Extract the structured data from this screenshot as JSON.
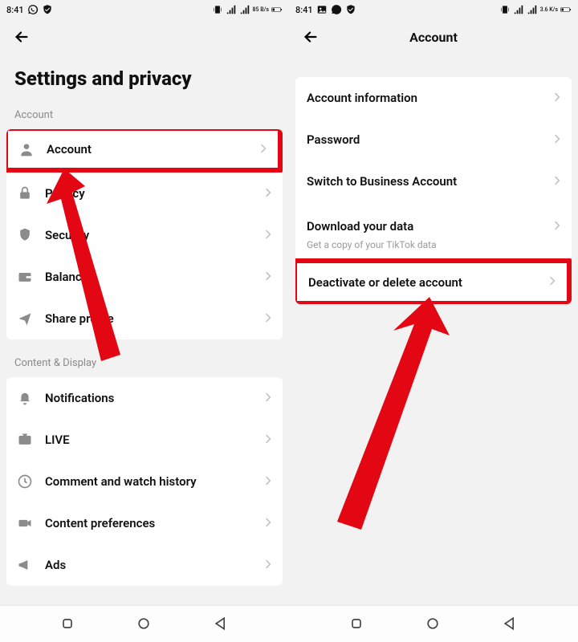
{
  "left": {
    "statusbar": {
      "time": "8:41",
      "net_label": "85 B/s"
    },
    "title": "Settings and privacy",
    "section1_label": "Account",
    "rows1": [
      {
        "label": "Account"
      },
      {
        "label": "Privacy"
      },
      {
        "label": "Security"
      },
      {
        "label": "Balance"
      },
      {
        "label": "Share profile"
      }
    ],
    "section2_label": "Content & Display",
    "rows2": [
      {
        "label": "Notifications"
      },
      {
        "label": "LIVE"
      },
      {
        "label": "Comment and watch history"
      },
      {
        "label": "Content preferences"
      },
      {
        "label": "Ads"
      }
    ]
  },
  "right": {
    "statusbar": {
      "time": "8:41",
      "net_label": "3.6 K/s"
    },
    "topbar_title": "Account",
    "rows": [
      {
        "label": "Account information"
      },
      {
        "label": "Password"
      },
      {
        "label": "Switch to Business Account"
      },
      {
        "label": "Download your data",
        "sub": "Get a copy of your TikTok data"
      },
      {
        "label": "Deactivate or delete account"
      }
    ]
  }
}
